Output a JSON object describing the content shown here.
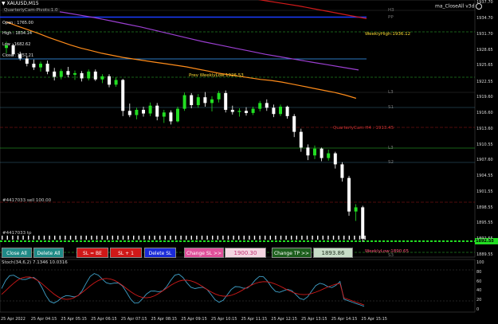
{
  "symbol_header": "XAUUSD,M15",
  "indicator_label": "QuarterlyCam-Pivots:1.0",
  "ea_label": "ma_CloseAll v3d",
  "info_panel": {
    "open": "Open : 1765.00",
    "high": "High : 1834.14",
    "low": "Low : 1682.62",
    "close": "Close : 1757.21"
  },
  "price_axis": [
    "1937.70",
    "1934.70",
    "1931.70",
    "1928.65",
    "1925.65",
    "1922.55",
    "1919.60",
    "1916.60",
    "1913.60",
    "1910.55",
    "1907.60",
    "1904.55",
    "1901.55",
    "1898.55",
    "1895.55",
    "1892.55",
    "1889.55"
  ],
  "current_price": "1892.55",
  "level_labels": {
    "h3": "H3",
    "pp": "PP",
    "l3": "L3",
    "s1": "S1",
    "l3b": "L3",
    "s2": "S2",
    "s3": "S3",
    "weekly_high": "WeeklyHigh:1936.12",
    "weekly_low": "WeeklyLow:1890.65",
    "prev_weekly_low": "Prev WeeklyLow:1926.53",
    "quarterly_cam": "QuarterlyCam H4 : 1913.45",
    "pending_1": "#4417033 sell 100.00",
    "pending_2": "#4417033 tp"
  },
  "buttons": {
    "close_all": "Close All",
    "delete_all": "Delete All",
    "sl_be": "SL = BE",
    "sl_plus": "SL + 1",
    "delete_sl": "Delete SL",
    "change_sl": "Change SL >>",
    "change_tp": "Change TP >>"
  },
  "inputs": {
    "sl_value": "1900.30",
    "tp_value": "1893.86"
  },
  "stoch_label": "Stoch(34,6,2) 7.1346 10.0316",
  "stoch_axis": [
    "100",
    "80",
    "60",
    "40",
    "20",
    "0"
  ],
  "time_axis": [
    "25 Apr 2022",
    "25 Apr 04:15",
    "25 Apr 05:15",
    "25 Apr 06:15",
    "25 Apr 07:15",
    "25 Apr 08:15",
    "25 Apr 09:15",
    "25 Apr 10:15",
    "25 Apr 11:15",
    "25 Apr 12:15",
    "25 Apr 13:15",
    "25 Apr 14:15",
    "25 Apr 15:15"
  ],
  "colors": {
    "bull": "#22dd22",
    "bear": "#ffffff",
    "sma_fast": "#ff8c1a",
    "sma_mid": "#9b3fd1",
    "sma_slow": "#d11a1a",
    "stoch_main": "#3fa0c8",
    "stoch_signal": "#d11a1a"
  },
  "chart_data": {
    "type": "candlestick",
    "symbol": "XAUUSD",
    "timeframe": "M15",
    "ylim": [
      1889.55,
      1937.7
    ],
    "candles": [
      {
        "o": 1929.0,
        "h": 1930.2,
        "l": 1928.0,
        "c": 1929.5
      },
      {
        "o": 1929.5,
        "h": 1929.8,
        "l": 1927.4,
        "c": 1927.8
      },
      {
        "o": 1927.8,
        "h": 1928.3,
        "l": 1926.6,
        "c": 1927.0
      },
      {
        "o": 1927.0,
        "h": 1927.5,
        "l": 1925.5,
        "c": 1926.0
      },
      {
        "o": 1926.0,
        "h": 1926.8,
        "l": 1924.8,
        "c": 1925.3
      },
      {
        "o": 1925.3,
        "h": 1926.4,
        "l": 1924.5,
        "c": 1926.0
      },
      {
        "o": 1926.0,
        "h": 1926.6,
        "l": 1924.0,
        "c": 1924.5
      },
      {
        "o": 1924.5,
        "h": 1925.2,
        "l": 1922.8,
        "c": 1923.5
      },
      {
        "o": 1923.5,
        "h": 1925.0,
        "l": 1923.0,
        "c": 1924.6
      },
      {
        "o": 1924.6,
        "h": 1925.4,
        "l": 1923.4,
        "c": 1923.9
      },
      {
        "o": 1923.9,
        "h": 1924.7,
        "l": 1922.9,
        "c": 1924.2
      },
      {
        "o": 1924.2,
        "h": 1924.6,
        "l": 1922.6,
        "c": 1923.2
      },
      {
        "o": 1923.2,
        "h": 1924.9,
        "l": 1922.8,
        "c": 1924.5
      },
      {
        "o": 1924.5,
        "h": 1924.9,
        "l": 1922.7,
        "c": 1923.0
      },
      {
        "o": 1923.0,
        "h": 1924.0,
        "l": 1922.3,
        "c": 1923.6
      },
      {
        "o": 1923.6,
        "h": 1924.0,
        "l": 1921.5,
        "c": 1922.0
      },
      {
        "o": 1922.0,
        "h": 1923.4,
        "l": 1921.6,
        "c": 1922.9
      },
      {
        "o": 1922.9,
        "h": 1923.1,
        "l": 1916.0,
        "c": 1917.0
      },
      {
        "o": 1917.0,
        "h": 1918.4,
        "l": 1915.8,
        "c": 1916.2
      },
      {
        "o": 1916.2,
        "h": 1917.6,
        "l": 1915.4,
        "c": 1917.2
      },
      {
        "o": 1917.2,
        "h": 1917.8,
        "l": 1915.9,
        "c": 1916.5
      },
      {
        "o": 1916.5,
        "h": 1918.6,
        "l": 1916.0,
        "c": 1918.0
      },
      {
        "o": 1918.0,
        "h": 1918.5,
        "l": 1915.2,
        "c": 1915.9
      },
      {
        "o": 1915.9,
        "h": 1917.2,
        "l": 1914.7,
        "c": 1916.7
      },
      {
        "o": 1916.7,
        "h": 1917.1,
        "l": 1914.4,
        "c": 1915.0
      },
      {
        "o": 1915.0,
        "h": 1917.8,
        "l": 1914.8,
        "c": 1917.4
      },
      {
        "o": 1917.4,
        "h": 1920.5,
        "l": 1917.0,
        "c": 1920.0
      },
      {
        "o": 1920.0,
        "h": 1920.4,
        "l": 1917.5,
        "c": 1918.1
      },
      {
        "o": 1918.1,
        "h": 1920.2,
        "l": 1917.6,
        "c": 1919.6
      },
      {
        "o": 1919.6,
        "h": 1920.6,
        "l": 1917.8,
        "c": 1918.5
      },
      {
        "o": 1918.5,
        "h": 1919.8,
        "l": 1916.9,
        "c": 1919.2
      },
      {
        "o": 1919.2,
        "h": 1920.8,
        "l": 1918.6,
        "c": 1920.4
      },
      {
        "o": 1920.4,
        "h": 1920.9,
        "l": 1916.7,
        "c": 1917.2
      },
      {
        "o": 1917.2,
        "h": 1918.0,
        "l": 1916.3,
        "c": 1916.8
      },
      {
        "o": 1916.8,
        "h": 1917.5,
        "l": 1915.9,
        "c": 1917.0
      },
      {
        "o": 1917.0,
        "h": 1917.7,
        "l": 1916.1,
        "c": 1916.6
      },
      {
        "o": 1916.6,
        "h": 1917.8,
        "l": 1916.2,
        "c": 1917.4
      },
      {
        "o": 1917.4,
        "h": 1918.9,
        "l": 1916.9,
        "c": 1918.5
      },
      {
        "o": 1918.5,
        "h": 1919.2,
        "l": 1917.0,
        "c": 1917.6
      },
      {
        "o": 1917.6,
        "h": 1918.2,
        "l": 1915.8,
        "c": 1916.4
      },
      {
        "o": 1916.4,
        "h": 1918.2,
        "l": 1916.0,
        "c": 1917.8
      },
      {
        "o": 1917.8,
        "h": 1918.0,
        "l": 1915.5,
        "c": 1916.0
      },
      {
        "o": 1916.0,
        "h": 1916.4,
        "l": 1912.0,
        "c": 1913.0
      },
      {
        "o": 1913.0,
        "h": 1913.6,
        "l": 1909.2,
        "c": 1910.0
      },
      {
        "o": 1910.0,
        "h": 1910.6,
        "l": 1907.6,
        "c": 1908.5
      },
      {
        "o": 1908.5,
        "h": 1910.4,
        "l": 1907.8,
        "c": 1909.8
      },
      {
        "o": 1909.8,
        "h": 1910.0,
        "l": 1907.4,
        "c": 1908.0
      },
      {
        "o": 1908.0,
        "h": 1909.6,
        "l": 1907.5,
        "c": 1908.9
      },
      {
        "o": 1908.9,
        "h": 1909.2,
        "l": 1906.0,
        "c": 1906.8
      },
      {
        "o": 1906.8,
        "h": 1907.2,
        "l": 1903.5,
        "c": 1904.2
      },
      {
        "o": 1904.2,
        "h": 1904.6,
        "l": 1897.0,
        "c": 1897.8
      },
      {
        "o": 1897.8,
        "h": 1899.2,
        "l": 1896.0,
        "c": 1898.6
      },
      {
        "o": 1898.6,
        "h": 1898.9,
        "l": 1892.0,
        "c": 1892.6
      }
    ],
    "moving_averages": [
      {
        "color": "sma_fast",
        "points": [
          1934.0,
          1933.2,
          1932.5,
          1931.8,
          1931.0,
          1930.3,
          1929.6,
          1929.0,
          1928.5,
          1928.0,
          1927.6,
          1927.2,
          1926.9,
          1926.6,
          1926.3,
          1926.0,
          1925.7,
          1925.4,
          1925.0,
          1924.6,
          1924.2,
          1923.9,
          1923.6,
          1923.3,
          1923.0,
          1922.8,
          1922.5,
          1922.1,
          1921.7,
          1921.3,
          1920.9,
          1920.5,
          1920.0,
          1919.4
        ]
      },
      {
        "color": "sma_mid",
        "points": [
          1936.2,
          1935.8,
          1935.3,
          1934.8,
          1934.2,
          1933.6,
          1933.0,
          1932.3,
          1931.6,
          1930.9,
          1930.2,
          1929.6,
          1929.0,
          1928.4,
          1927.8,
          1927.3,
          1926.8,
          1926.3,
          1925.8,
          1925.3,
          1924.8
        ]
      },
      {
        "color": "sma_slow",
        "points": [
          1940.0,
          1939.5,
          1939.0,
          1938.5,
          1938.0,
          1937.5,
          1937.0,
          1936.4,
          1935.8,
          1935.2,
          1934.6
        ]
      }
    ],
    "stochastic": {
      "period": "34,6,2",
      "main": 7.1346,
      "signal": 10.0316,
      "levels": [
        80,
        20
      ],
      "ylim": [
        0,
        100
      ]
    }
  }
}
